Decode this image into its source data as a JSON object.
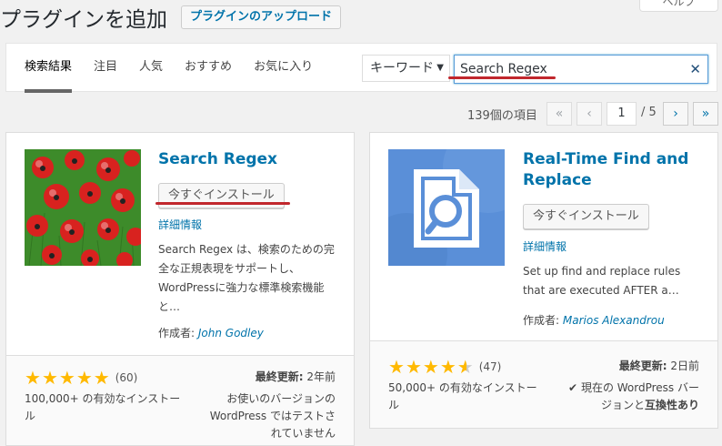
{
  "header": {
    "title": "プラグインを追加",
    "upload_label": "プラグインのアップロード",
    "help_label": "ヘルプ"
  },
  "filters": {
    "tabs": [
      {
        "label": "検索結果"
      },
      {
        "label": "注目"
      },
      {
        "label": "人気"
      },
      {
        "label": "おすすめ"
      },
      {
        "label": "お気に入り"
      }
    ],
    "search_type": "キーワード",
    "search_value": "Search Regex"
  },
  "pagination": {
    "items_count": "139個の項目",
    "first": "«",
    "prev": "‹",
    "current_page": "1",
    "total": "/ 5",
    "next": "›",
    "last": "»"
  },
  "plugins": [
    {
      "name": "Search Regex",
      "install_label": "今すぐインストール",
      "details_label": "詳細情報",
      "description": "Search Regex は、検索のための完全な正規表現をサポートし、WordPressに強力な標準検索機能と…",
      "author_prefix": "作成者:",
      "author": "John Godley",
      "rating": 5,
      "rating_count": "(60)",
      "last_updated_label": "最終更新:",
      "last_updated": "2年前",
      "installs": "100,000+ の有効なインストール",
      "compat": "お使いのバージョンの WordPress ではテストされていません"
    },
    {
      "name": "Real-Time Find and Replace",
      "install_label": "今すぐインストール",
      "details_label": "詳細情報",
      "description": "Set up find and replace rules that are executed AFTER a…",
      "author_prefix": "作成者:",
      "author": "Marios Alexandrou",
      "rating": 4.5,
      "rating_count": "(47)",
      "last_updated_label": "最終更新:",
      "last_updated": "2日前",
      "installs": "50,000+ の有効なインストール",
      "compat_check": "✔",
      "compat_prefix": "現在の WordPress バージョンと",
      "compat_bold": "互換性あり"
    }
  ],
  "colors": {
    "accent": "#0073aa",
    "highlight": "#c1272d",
    "star": "#ffb900"
  }
}
